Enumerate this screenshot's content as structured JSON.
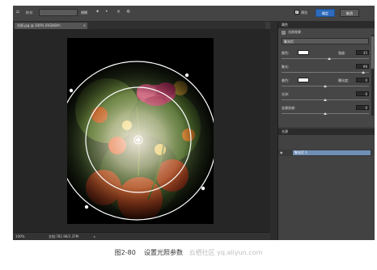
{
  "options_bar": {
    "style_label": "样式:",
    "style_value": "",
    "blur_label": "模糊",
    "mode_label": "",
    "preview_label": "预览",
    "ok_label": "确定",
    "cancel_label": "取消"
  },
  "document": {
    "tab_title": "光照.jpg @ 100% (RGB/8#)",
    "status_zoom": "100%",
    "status_doc": "文档:781.9K/1.37M"
  },
  "properties_panel": {
    "header": "属性",
    "title": "光照效果",
    "preset_value": "聚光灯",
    "rows": [
      {
        "label": "颜色:",
        "swatch": "#ffffff",
        "label2": "强度:",
        "value": "35",
        "level": 0.55
      },
      {
        "label": "聚光:",
        "value": "96",
        "level": 0.95
      },
      {
        "label": "着色:",
        "swatch": "#ffffff",
        "label2": "曝光度:",
        "value": "0",
        "level": 0.5
      },
      {
        "label": "光泽:",
        "value": "0",
        "level": 0.5
      },
      {
        "label": "金属质感:",
        "value": "0",
        "level": 0.5
      }
    ]
  },
  "lights_panel": {
    "header": "光源",
    "layer_name": "聚光灯 1"
  },
  "caption": {
    "figure": "图2-80",
    "text": "设置光照参数",
    "watermark": "云栖社区 yq.aliyun.com"
  },
  "colors": {
    "ok_button": "#2f6bbd",
    "selected_layer": "#6f8fb6"
  }
}
